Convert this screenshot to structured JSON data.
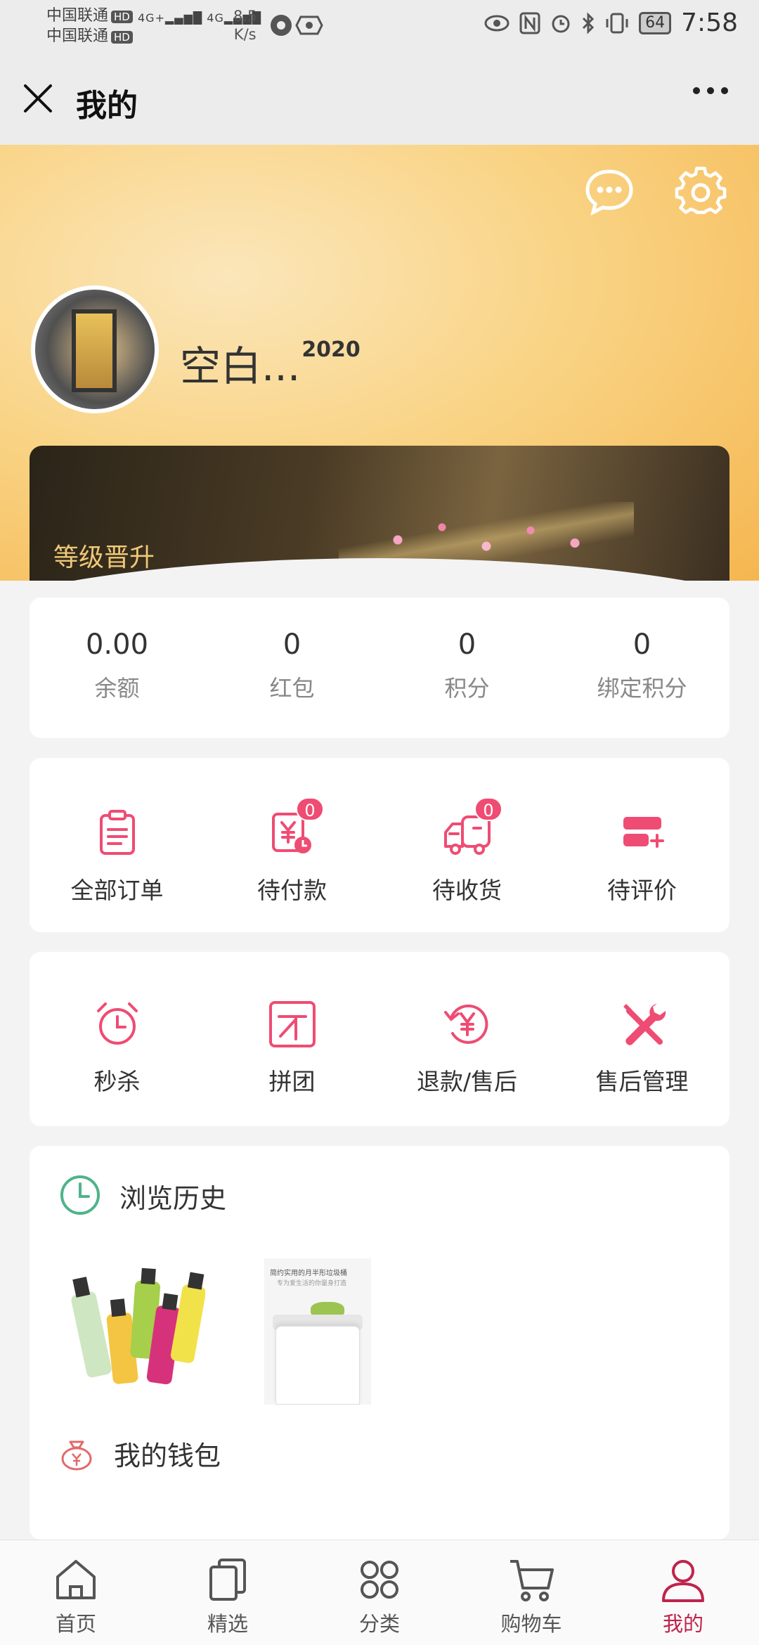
{
  "status_bar": {
    "carrier1": "中国联通",
    "carrier2": "中国联通",
    "hd": "HD",
    "net1": "4G+",
    "net2": "4G",
    "speed_value": "8.5",
    "speed_unit": "K/s",
    "battery": "64",
    "time": "7:58"
  },
  "nav": {
    "title": "我的",
    "close_icon": "close-icon",
    "more_icon": "more-dots-icon"
  },
  "profile": {
    "name": "空白...",
    "name_sup": "2020",
    "level_label": "等级晋升"
  },
  "stats": [
    {
      "value": "0.00",
      "label": "余额"
    },
    {
      "value": "0",
      "label": "红包"
    },
    {
      "value": "0",
      "label": "积分"
    },
    {
      "value": "0",
      "label": "绑定积分"
    }
  ],
  "orders": [
    {
      "label": "全部订单",
      "icon": "clipboard-icon"
    },
    {
      "label": "待付款",
      "icon": "payment-pending-icon",
      "badge": "0"
    },
    {
      "label": "待收货",
      "icon": "delivery-truck-icon",
      "badge": "0"
    },
    {
      "label": "待评价",
      "icon": "review-card-icon"
    }
  ],
  "tools": [
    {
      "label": "秒杀",
      "icon": "alarm-clock-icon"
    },
    {
      "label": "拼团",
      "icon": "group-buy-icon"
    },
    {
      "label": "退款/售后",
      "icon": "refund-icon"
    },
    {
      "label": "售后管理",
      "icon": "wrench-screwdriver-icon"
    }
  ],
  "history": {
    "title": "浏览历史",
    "thumb2_caption": "简约实用的月半形垃圾桶",
    "thumb2_sub": "专为爱生活的你量身打造"
  },
  "wallet": {
    "label": "我的钱包"
  },
  "tabbar": [
    {
      "label": "首页",
      "icon": "home-icon"
    },
    {
      "label": "精选",
      "icon": "featured-icon"
    },
    {
      "label": "分类",
      "icon": "category-icon"
    },
    {
      "label": "购物车",
      "icon": "cart-icon"
    },
    {
      "label": "我的",
      "icon": "user-icon",
      "active": true
    }
  ],
  "colors": {
    "accent": "#ef4c73",
    "tab_active": "#c0234b",
    "header_gradient": "#f9d486"
  }
}
